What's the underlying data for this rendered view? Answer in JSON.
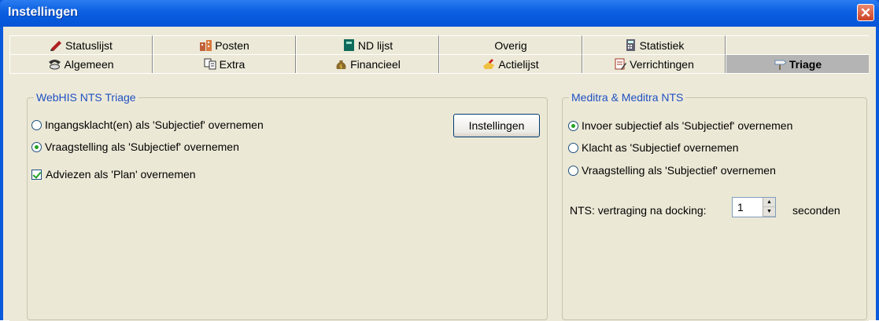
{
  "window": {
    "title": "Instellingen",
    "close_glyph": "✕"
  },
  "tabs": {
    "row1": [
      {
        "label": "Statuslijst",
        "icon": "pen-icon"
      },
      {
        "label": "Posten",
        "icon": "building-icon"
      },
      {
        "label": "ND lijst",
        "icon": "book-icon"
      },
      {
        "label": "Overig",
        "icon": ""
      },
      {
        "label": "Statistiek",
        "icon": "calculator-icon"
      },
      {
        "label": "",
        "icon": ""
      }
    ],
    "row2": [
      {
        "label": "Algemeen",
        "icon": "phone-icon"
      },
      {
        "label": "Extra",
        "icon": "copy-icon"
      },
      {
        "label": "Financieel",
        "icon": "money-bag-icon"
      },
      {
        "label": "Actielijst",
        "icon": "hand-icon"
      },
      {
        "label": "Verrichtingen",
        "icon": "notes-icon"
      },
      {
        "label": "Triage",
        "icon": "signpost-icon"
      }
    ],
    "active": "Triage"
  },
  "webhis": {
    "title": "WebHIS NTS Triage",
    "options": [
      {
        "label": "Ingangsklacht(en) als 'Subjectief' overnemen",
        "checked": false
      },
      {
        "label": "Vraagstelling als 'Subjectief' overnemen",
        "checked": true
      }
    ],
    "advies": {
      "label": "Adviezen als 'Plan' overnemen",
      "checked": true
    },
    "settings_button": "Instellingen"
  },
  "meditra": {
    "title": "Meditra & Meditra NTS",
    "options": [
      {
        "label": "Invoer subjectief als 'Subjectief' overnemen",
        "checked": true
      },
      {
        "label": "Klacht as 'Subjectief overnemen",
        "checked": false
      },
      {
        "label": "Vraagstelling als 'Subjectief' overnemen",
        "checked": false
      }
    ],
    "delay_label": "NTS: vertraging na docking:",
    "delay_value": "1",
    "delay_unit": "seconden"
  }
}
